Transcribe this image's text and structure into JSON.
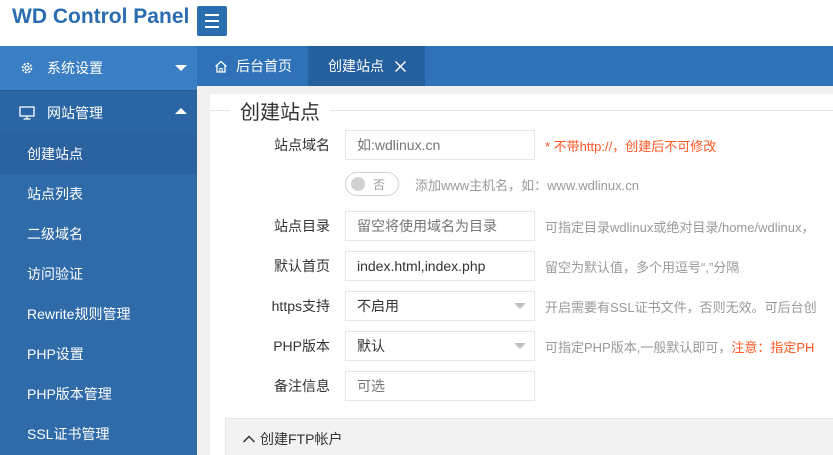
{
  "header": {
    "logo": "WD Control Panel",
    "menu_icon": "hamburger-icon"
  },
  "sidebar": {
    "groups": [
      {
        "label": "系统设置",
        "icon": "gear-icon",
        "expanded": false
      },
      {
        "label": "网站管理",
        "icon": "monitor-icon",
        "expanded": true
      }
    ],
    "items": [
      {
        "label": "创建站点"
      },
      {
        "label": "站点列表"
      },
      {
        "label": "二级域名"
      },
      {
        "label": "访问验证"
      },
      {
        "label": "Rewrite规则管理"
      },
      {
        "label": "PHP设置"
      },
      {
        "label": "PHP版本管理"
      },
      {
        "label": "SSL证书管理"
      }
    ]
  },
  "tabs": {
    "home": {
      "label": "后台首页",
      "icon": "home-icon"
    },
    "current": {
      "label": "创建站点",
      "close_icon": "close-icon"
    }
  },
  "form": {
    "title": "创建站点",
    "domain": {
      "label": "站点域名",
      "placeholder": "如:wdlinux.cn",
      "hint": "* 不带http://，创建后不可修改"
    },
    "www_switch": {
      "state": "否",
      "hint": "添加www主机名，如：www.wdlinux.cn"
    },
    "dir": {
      "label": "站点目录",
      "placeholder": "留空将使用域名为目录",
      "hint": "可指定目录wdlinux或绝对目录/home/wdlinux，"
    },
    "index": {
      "label": "默认首页",
      "value": "index.html,index.php",
      "hint": "留空为默认值，多个用逗号“,”分隔"
    },
    "https": {
      "label": "https支持",
      "value": "不启用",
      "hint": "开启需要有SSL证书文件，否则无效。可后台创"
    },
    "php": {
      "label": "PHP版本",
      "value": "默认",
      "hint": "可指定PHP版本,一般默认即可，",
      "warn": "注意：指定PH"
    },
    "note": {
      "label": "备注信息",
      "placeholder": "可选"
    }
  },
  "ftp": {
    "label": "创建FTP帐户",
    "icon": "chevron-up-icon"
  },
  "colors": {
    "brand": "#2a6cb0",
    "sidebar": "#2f6ba9",
    "warn": "#ff5722"
  }
}
